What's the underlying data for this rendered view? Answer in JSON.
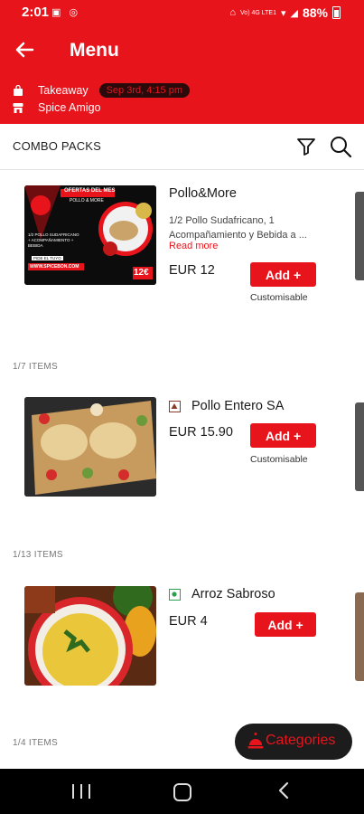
{
  "status_bar": {
    "time": "2:01",
    "battery": "88%",
    "signal_text": "Vo) 4G LTE1"
  },
  "header": {
    "title": "Menu",
    "order_type": "Takeaway",
    "schedule": "Sep 3rd, 4:15 pm",
    "store_name": "Spice Amigo"
  },
  "toolbar": {
    "category_title": "COMBO PACKS"
  },
  "colors": {
    "brand_red": "#e8141c",
    "dark": "#1c1c1c",
    "veg_green": "#2aa14a",
    "nonveg_brown": "#8b3a2a"
  },
  "products": [
    {
      "name": "Pollo&More",
      "description": "1/2 Pollo Sudafricano, 1 Acompañamiento y Bebida a ...",
      "read_more": "Read more",
      "price": "EUR 12",
      "add_label": "Add +",
      "customisable": "Customisable",
      "count": "1/7 ITEMS",
      "image_text": {
        "headline": "OFERTAS DEL MES",
        "sub": "POLLO & MORE",
        "info": "1/2 POLLO SUDAFRICANO + ACOMPAÑAMIENTO + BEBIDA",
        "cta": "PIDE EL TUYO",
        "web": "WWW.SPICEBON.COM",
        "price_tag": "12€"
      }
    },
    {
      "name": "Pollo Entero SA",
      "price": "EUR 15.90",
      "add_label": "Add +",
      "customisable": "Customisable",
      "count": "1/13 ITEMS",
      "marker": "non-veg"
    },
    {
      "name": "Arroz Sabroso",
      "price": "EUR 4",
      "add_label": "Add +",
      "count": "1/4 ITEMS",
      "marker": "veg"
    }
  ],
  "categories_button": "Categories"
}
